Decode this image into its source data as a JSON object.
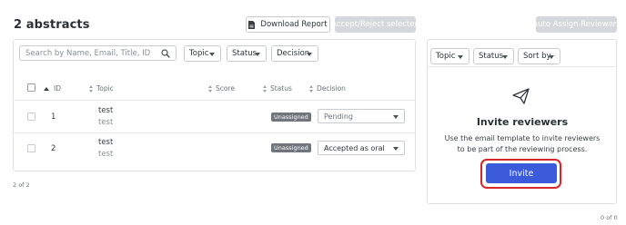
{
  "header": {
    "title": "2 abstracts",
    "download_label": "Download Report",
    "accept_reject_label": "Accept/Reject selected",
    "auto_assign_label": "Auto Assign Reviewers"
  },
  "filters": {
    "search_placeholder": "Search by Name, Email, Title, ID",
    "topic_label": "Topic",
    "status_label": "Status",
    "decision_label": "Decision"
  },
  "table": {
    "columns": [
      "ID",
      "Topic",
      "Score",
      "Status",
      "Decision"
    ],
    "rows": [
      {
        "id": "1",
        "topic": "test",
        "topic_sub": "test",
        "status": "Unassigned",
        "decision": "Pending"
      },
      {
        "id": "2",
        "topic": "test",
        "topic_sub": "test",
        "status": "Unassigned",
        "decision": "Accepted as oral"
      }
    ],
    "count_text": "2 of 2"
  },
  "reviewers": {
    "topic_label": "Topic",
    "status_label": "Status",
    "sort_label": "Sort by",
    "invite_title": "Invite reviewers",
    "invite_desc_line1": "Use the email template to invite reviewers",
    "invite_desc_line2": "to be part of the reviewing process.",
    "invite_button": "Invite",
    "count_text": "0 of 0"
  },
  "colors": {
    "primary": "#3b5bdb",
    "highlight": "#d6282c",
    "badge": "#6f757b"
  },
  "icons": {
    "download": "document-icon",
    "search": "search-icon",
    "invite": "paper-plane-icon"
  }
}
